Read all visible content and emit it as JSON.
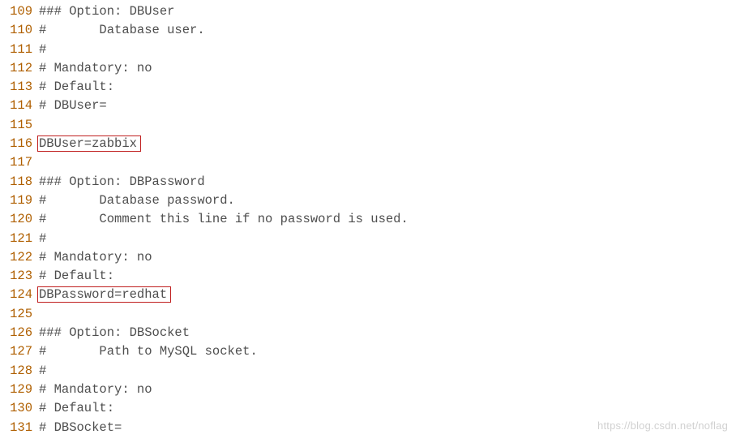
{
  "watermark": "https://blog.csdn.net/noflag",
  "lines": [
    {
      "num": "109",
      "text": "### Option: DBUser",
      "highlight": false
    },
    {
      "num": "110",
      "text": "#       Database user.",
      "highlight": false
    },
    {
      "num": "111",
      "text": "#",
      "highlight": false
    },
    {
      "num": "112",
      "text": "# Mandatory: no",
      "highlight": false
    },
    {
      "num": "113",
      "text": "# Default:",
      "highlight": false
    },
    {
      "num": "114",
      "text": "# DBUser=",
      "highlight": false
    },
    {
      "num": "115",
      "text": "",
      "highlight": false
    },
    {
      "num": "116",
      "text": "DBUser=zabbix",
      "highlight": true
    },
    {
      "num": "117",
      "text": "",
      "highlight": false
    },
    {
      "num": "118",
      "text": "### Option: DBPassword",
      "highlight": false
    },
    {
      "num": "119",
      "text": "#       Database password.",
      "highlight": false
    },
    {
      "num": "120",
      "text": "#       Comment this line if no password is used.",
      "highlight": false
    },
    {
      "num": "121",
      "text": "#",
      "highlight": false
    },
    {
      "num": "122",
      "text": "# Mandatory: no",
      "highlight": false
    },
    {
      "num": "123",
      "text": "# Default:",
      "highlight": false
    },
    {
      "num": "124",
      "text": "DBPassword=redhat",
      "highlight": true
    },
    {
      "num": "125",
      "text": "",
      "highlight": false
    },
    {
      "num": "126",
      "text": "### Option: DBSocket",
      "highlight": false
    },
    {
      "num": "127",
      "text": "#       Path to MySQL socket.",
      "highlight": false
    },
    {
      "num": "128",
      "text": "#",
      "highlight": false
    },
    {
      "num": "129",
      "text": "# Mandatory: no",
      "highlight": false
    },
    {
      "num": "130",
      "text": "# Default:",
      "highlight": false
    },
    {
      "num": "131",
      "text": "# DBSocket=",
      "highlight": false
    }
  ]
}
